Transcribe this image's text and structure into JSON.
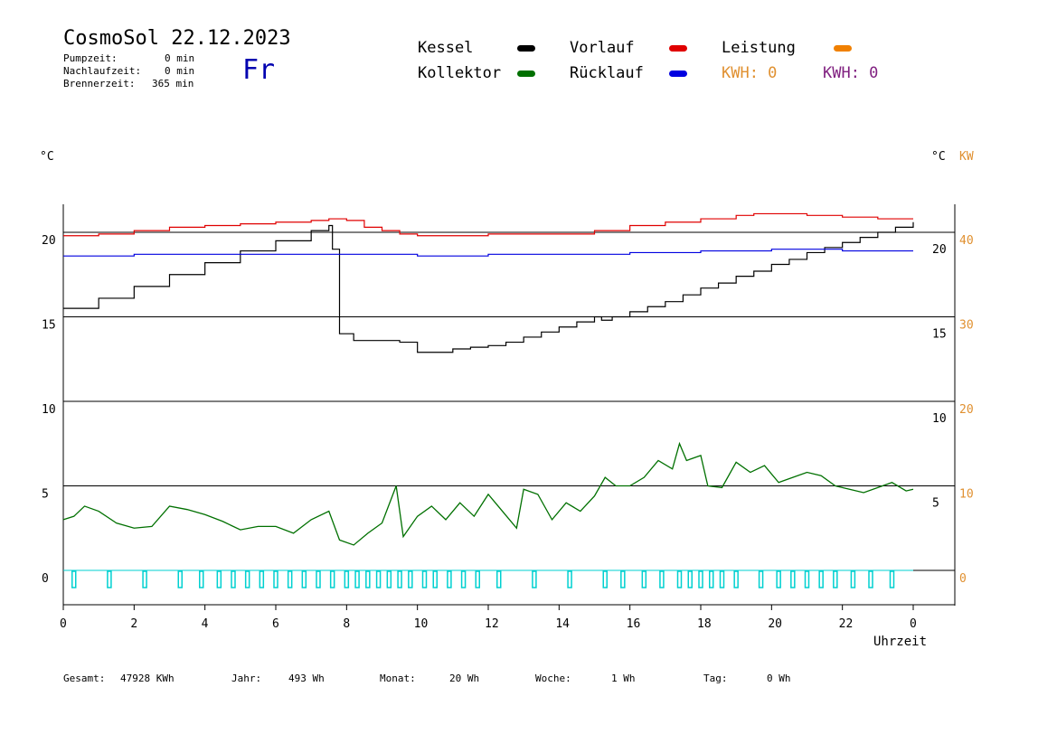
{
  "header": {
    "title": "CosmoSol 22.12.2023",
    "day": "Fr",
    "stats": [
      {
        "label": "Pumpzeit:",
        "value": "0 min"
      },
      {
        "label": "Nachlaufzeit:",
        "value": "0 min"
      },
      {
        "label": "Brennerzeit:",
        "value": "365 min"
      }
    ]
  },
  "legend": {
    "kessel": {
      "label": "Kessel",
      "color": "#000000"
    },
    "kollektor": {
      "label": "Kollektor",
      "color": "#007000"
    },
    "vorlauf": {
      "label": "Vorlauf",
      "color": "#e00000"
    },
    "ruecklauf": {
      "label": "Rücklauf",
      "color": "#0000e0"
    },
    "leistung": {
      "label": "Leistung",
      "color": "#f08000"
    },
    "kwh_orange": "KWH: 0",
    "kwh_purple": "KWH: 0"
  },
  "footer": {
    "gesamt_label": "Gesamt:",
    "gesamt_value": "47928 KWh",
    "jahr_label": "Jahr:",
    "jahr_value": "493 Wh",
    "monat_label": "Monat:",
    "monat_value": "20 Wh",
    "woche_label": "Woche:",
    "woche_value": "1 Wh",
    "tag_label": "Tag:",
    "tag_value": "0 Wh"
  },
  "chart_data": {
    "type": "line",
    "xlabel": "Uhrzeit",
    "xlim": [
      0,
      24
    ],
    "x_ticks": [
      0,
      2,
      4,
      6,
      8,
      10,
      12,
      14,
      16,
      18,
      20,
      22,
      0
    ],
    "left_ylabel": "°C",
    "left_ticks": [
      0,
      5,
      10,
      15,
      20
    ],
    "left_ylim": [
      -2,
      22
    ],
    "right_inner_label": "°C",
    "right_inner_ticks": [
      5,
      10,
      15,
      20
    ],
    "right_outer_label": "KW",
    "right_outer_ticks": [
      0,
      10,
      20,
      30,
      40
    ],
    "grid_y": [
      0,
      5,
      10,
      15,
      20
    ],
    "series": [
      {
        "name": "Kessel",
        "color": "#000000",
        "x": [
          0,
          1,
          2,
          3,
          4,
          5,
          6,
          7,
          7.5,
          7.6,
          7.8,
          8.2,
          8.5,
          9,
          9.5,
          10,
          10.5,
          11,
          11.5,
          12,
          12.5,
          13,
          13.5,
          14,
          14.5,
          15,
          15.2,
          15.5,
          16,
          16.5,
          17,
          17.5,
          18,
          18.5,
          19,
          19.5,
          20,
          20.5,
          21,
          21.5,
          22,
          22.5,
          23,
          23.5,
          24
        ],
        "values": [
          15.5,
          16.1,
          16.8,
          17.5,
          18.2,
          18.9,
          19.5,
          20.1,
          20.4,
          19.0,
          14.0,
          13.6,
          13.6,
          13.6,
          13.5,
          12.9,
          12.9,
          13.1,
          13.2,
          13.3,
          13.5,
          13.8,
          14.1,
          14.4,
          14.7,
          15.0,
          14.8,
          15.0,
          15.3,
          15.6,
          15.9,
          16.3,
          16.7,
          17.0,
          17.4,
          17.7,
          18.1,
          18.4,
          18.8,
          19.1,
          19.4,
          19.7,
          20.0,
          20.3,
          20.6
        ]
      },
      {
        "name": "Vorlauf",
        "color": "#e00000",
        "x": [
          0,
          1,
          2,
          3,
          4,
          5,
          6,
          7,
          7.5,
          8,
          8.5,
          9,
          9.5,
          10,
          11,
          12,
          13,
          14,
          15,
          16,
          17,
          18,
          19,
          19.5,
          20,
          21,
          22,
          23,
          24
        ],
        "values": [
          19.8,
          19.9,
          20.1,
          20.3,
          20.4,
          20.5,
          20.6,
          20.7,
          20.8,
          20.7,
          20.3,
          20.1,
          19.9,
          19.8,
          19.8,
          19.9,
          19.9,
          19.9,
          20.1,
          20.4,
          20.6,
          20.8,
          21.0,
          21.1,
          21.1,
          21.0,
          20.9,
          20.8,
          20.8
        ]
      },
      {
        "name": "Rücklauf",
        "color": "#0000e0",
        "x": [
          0,
          2,
          4,
          6,
          8,
          10,
          12,
          14,
          16,
          18,
          20,
          22,
          24
        ],
        "values": [
          18.6,
          18.7,
          18.7,
          18.7,
          18.7,
          18.6,
          18.7,
          18.7,
          18.8,
          18.9,
          19.0,
          18.9,
          18.9
        ]
      },
      {
        "name": "Kollektor",
        "color": "#007000",
        "x": [
          0,
          0.3,
          0.6,
          1,
          1.5,
          2,
          2.5,
          3,
          3.5,
          4,
          4.5,
          5,
          5.5,
          6,
          6.5,
          7,
          7.5,
          7.8,
          8.2,
          8.6,
          9,
          9.4,
          9.6,
          10,
          10.4,
          10.8,
          11.2,
          11.6,
          12,
          12.4,
          12.8,
          13,
          13.4,
          13.8,
          14.2,
          14.6,
          15,
          15.3,
          15.6,
          16,
          16.4,
          16.8,
          17.2,
          17.4,
          17.6,
          18,
          18.2,
          18.6,
          19,
          19.4,
          19.8,
          20.2,
          20.6,
          21,
          21.4,
          21.8,
          22.2,
          22.6,
          23,
          23.4,
          23.8,
          24
        ],
        "values": [
          3.0,
          3.2,
          3.8,
          3.5,
          2.8,
          2.5,
          2.6,
          3.8,
          3.6,
          3.3,
          2.9,
          2.4,
          2.6,
          2.6,
          2.2,
          3.0,
          3.5,
          1.8,
          1.5,
          2.2,
          2.8,
          5.0,
          2.0,
          3.2,
          3.8,
          3.0,
          4.0,
          3.2,
          4.5,
          3.5,
          2.5,
          4.8,
          4.5,
          3.0,
          4.0,
          3.5,
          4.4,
          5.5,
          5.0,
          5.0,
          5.5,
          6.5,
          6.0,
          7.5,
          6.5,
          6.8,
          5.0,
          4.9,
          6.4,
          5.8,
          6.2,
          5.2,
          5.5,
          5.8,
          5.6,
          5.0,
          4.8,
          4.6,
          4.9,
          5.2,
          4.7,
          4.8
        ]
      }
    ],
    "pulse_times": [
      0.3,
      1.3,
      2.3,
      3.3,
      3.9,
      4.4,
      4.8,
      5.2,
      5.6,
      6.0,
      6.4,
      6.8,
      7.2,
      7.6,
      8.0,
      8.3,
      8.6,
      8.9,
      9.2,
      9.5,
      9.8,
      10.2,
      10.5,
      10.9,
      11.3,
      11.7,
      12.3,
      13.3,
      14.3,
      15.3,
      15.8,
      16.4,
      16.9,
      17.4,
      17.7,
      18.0,
      18.3,
      18.6,
      19.0,
      19.7,
      20.2,
      20.6,
      21.0,
      21.4,
      21.8,
      22.3,
      22.8,
      23.4
    ],
    "pulse_color": "#00d0d0"
  }
}
